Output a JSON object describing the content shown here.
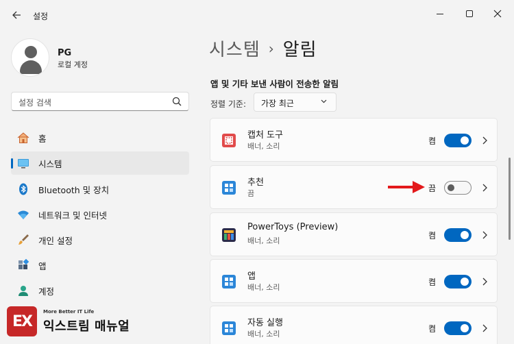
{
  "window": {
    "title": "설정"
  },
  "user": {
    "name": "PG",
    "account_type": "로컬 계정"
  },
  "search": {
    "placeholder": "설정 검색"
  },
  "sidebar": {
    "items": [
      {
        "label": "홈",
        "icon": "home-icon"
      },
      {
        "label": "시스템",
        "icon": "system-display-icon",
        "selected": true
      },
      {
        "label": "Bluetooth 및 장치",
        "icon": "bluetooth-icon"
      },
      {
        "label": "네트워크 및 인터넷",
        "icon": "wifi-icon"
      },
      {
        "label": "개인 설정",
        "icon": "paintbrush-icon"
      },
      {
        "label": "앱",
        "icon": "apps-icon"
      },
      {
        "label": "계정",
        "icon": "account-icon"
      }
    ]
  },
  "breadcrumb": {
    "parent": "시스템",
    "separator": "›",
    "current": "알림"
  },
  "section": {
    "title": "앱 및 기타 보낸 사람이 전송한 알림"
  },
  "sort": {
    "label": "정렬 기준:",
    "selected": "가장 최근"
  },
  "apps": [
    {
      "name": "캡처 도구",
      "subtitle": "배너, 소리",
      "state_label": "켬",
      "enabled": true,
      "icon": "snipping-tool-icon"
    },
    {
      "name": "추천",
      "subtitle": "끔",
      "state_label": "끔",
      "enabled": false,
      "icon": "app-tile-icon"
    },
    {
      "name": "PowerToys (Preview)",
      "subtitle": "배너, 소리",
      "state_label": "켬",
      "enabled": true,
      "icon": "powertoys-icon"
    },
    {
      "name": "앱",
      "subtitle": "배너, 소리",
      "state_label": "켬",
      "enabled": true,
      "icon": "app-tile-icon"
    },
    {
      "name": "자동 실행",
      "subtitle": "배너, 소리",
      "state_label": "켬",
      "enabled": true,
      "icon": "app-tile-icon"
    }
  ],
  "watermark": {
    "tagline": "More Better IT Life",
    "name": "익스트림 매뉴얼",
    "logo_text": "EX"
  },
  "colors": {
    "accent": "#0067c0",
    "arrow": "#e3191b",
    "logo": "#c62828"
  }
}
